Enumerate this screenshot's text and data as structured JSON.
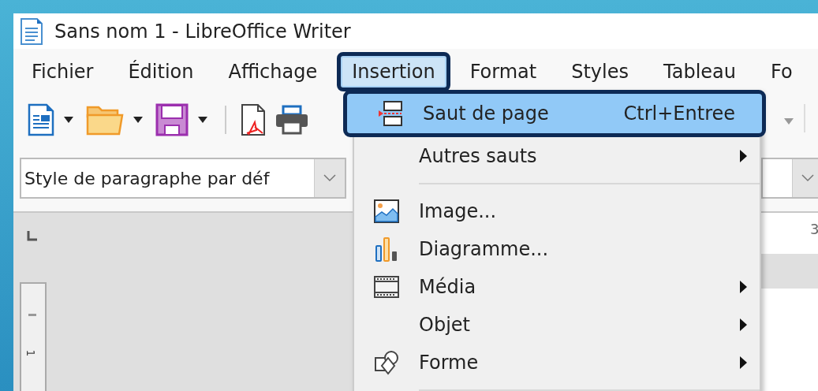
{
  "window": {
    "title": "Sans nom 1 - LibreOffice Writer"
  },
  "menubar": [
    {
      "label": "Fichier",
      "selected": false
    },
    {
      "label": "Édition",
      "selected": false
    },
    {
      "label": "Affichage",
      "selected": false
    },
    {
      "label": "Insertion",
      "selected": true
    },
    {
      "label": "Format",
      "selected": false
    },
    {
      "label": "Styles",
      "selected": false
    },
    {
      "label": "Tableau",
      "selected": false
    },
    {
      "label": "Fo",
      "selected": false
    }
  ],
  "toolbar": [
    {
      "kind": "new-document"
    },
    {
      "kind": "dropdown"
    },
    {
      "kind": "folder"
    },
    {
      "kind": "dropdown"
    },
    {
      "kind": "save"
    },
    {
      "kind": "dropdown"
    },
    {
      "kind": "separator"
    },
    {
      "kind": "pdf"
    },
    {
      "kind": "printer"
    }
  ],
  "paragraph_style": {
    "value": "Style de paragraphe par déf"
  },
  "ruler": {
    "horizontal_label": "3",
    "vertical_label": "1"
  },
  "menu": [
    {
      "kind": "page-break",
      "label": "Saut de page",
      "shortcut": "Ctrl+Entree",
      "submenu": false,
      "selected": true
    },
    {
      "kind": "plain",
      "label": "Autres sauts",
      "submenu": true,
      "selected": false
    },
    {
      "kind": "separator"
    },
    {
      "kind": "image",
      "label": "Image...",
      "submenu": false,
      "selected": false
    },
    {
      "kind": "chart",
      "label": "Diagramme...",
      "submenu": false,
      "selected": false
    },
    {
      "kind": "media",
      "label": "Média",
      "submenu": true,
      "selected": false
    },
    {
      "kind": "plain",
      "label": "Objet",
      "submenu": true,
      "selected": false
    },
    {
      "kind": "shape",
      "label": "Forme",
      "submenu": true,
      "selected": false
    },
    {
      "kind": "separator"
    }
  ]
}
